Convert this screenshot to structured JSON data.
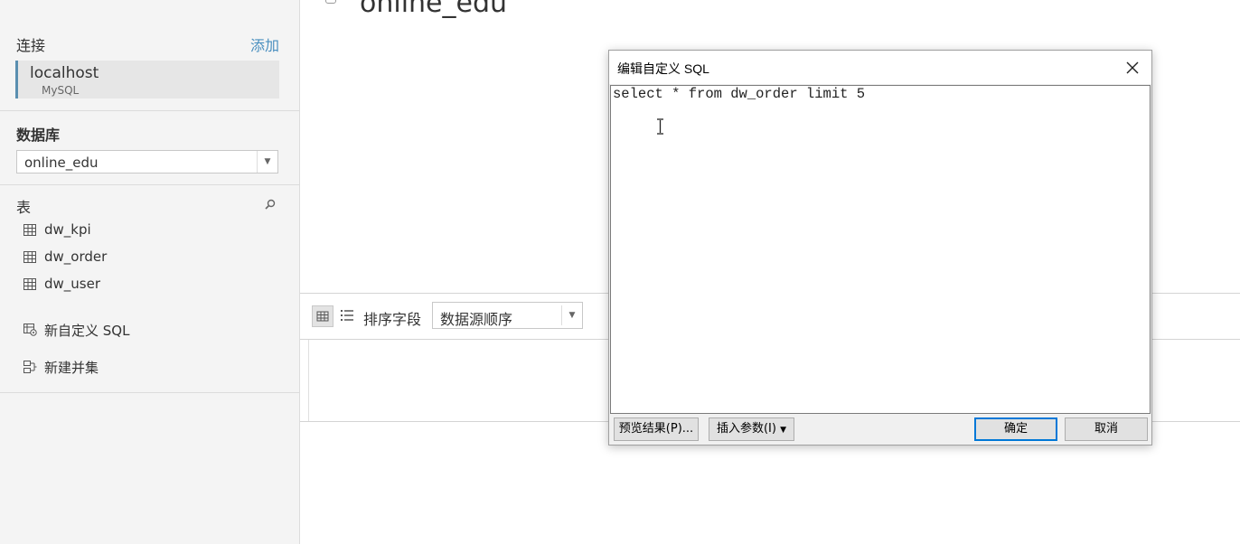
{
  "sidebar": {
    "connections_header": "连接",
    "add_label": "添加",
    "connection": {
      "name": "localhost",
      "type": "MySQL"
    },
    "database_header": "数据库",
    "database_selected": "online_edu",
    "tables_header": "表",
    "tables": [
      "dw_kpi",
      "dw_order",
      "dw_user"
    ],
    "new_custom_sql": "新自定义 SQL",
    "new_union": "新建并集"
  },
  "main": {
    "title": "online_edu",
    "sort_label": "排序字段",
    "sort_selected": "数据源顺序"
  },
  "dialog": {
    "title": "编辑自定义 SQL",
    "sql": "select * from dw_order limit 5",
    "preview_button": "预览结果(P)...",
    "insert_param_button": "插入参数(I)",
    "ok_button": "确定",
    "cancel_button": "取消"
  },
  "colors": {
    "accent": "#4a8fbf",
    "connection_bar": "#5a8fb0",
    "primary_border": "#0078d7"
  }
}
